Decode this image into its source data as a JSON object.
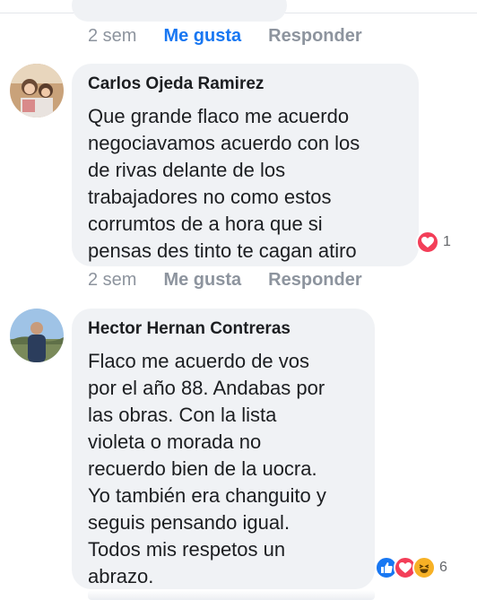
{
  "prev_comment": {
    "time": "2 sem",
    "like_label": "Me gusta",
    "reply_label": "Responder",
    "like_active_color": "#1877f2"
  },
  "comments": [
    {
      "author": "Carlos Ojeda Ramirez",
      "text_lines": [
        "Que grande flaco me acuerdo",
        "negociavamos acuerdo con los",
        "de rivas delante de los",
        "trabajadores no como estos",
        "corrumtos de a hora que si",
        "pensas des tinto te cagan atiro"
      ],
      "reaction_icons": [
        "love-icon"
      ],
      "reaction_count": "1",
      "time": "2 sem",
      "like_label": "Me gusta",
      "reply_label": "Responder"
    },
    {
      "author": "Hector Hernan Contreras",
      "text_lines": [
        "Flaco me acuerdo de vos",
        "por el año 88. Andabas por",
        "las obras. Con la lista",
        "violeta o morada no",
        "recuerdo bien de la uocra.",
        "Yo también era changuito y",
        "seguis pensando igual.",
        "Todos mis respetos un",
        "abrazo."
      ],
      "reaction_icons": [
        "like-icon",
        "love-icon",
        "haha-icon"
      ],
      "reaction_count": "6"
    }
  ],
  "colors": {
    "bubble": "#f0f2f5",
    "meta_text": "#8d949e",
    "like_blue": "#1877f2",
    "love_red": "#f33e58",
    "haha_yellow": "#f7b125"
  }
}
